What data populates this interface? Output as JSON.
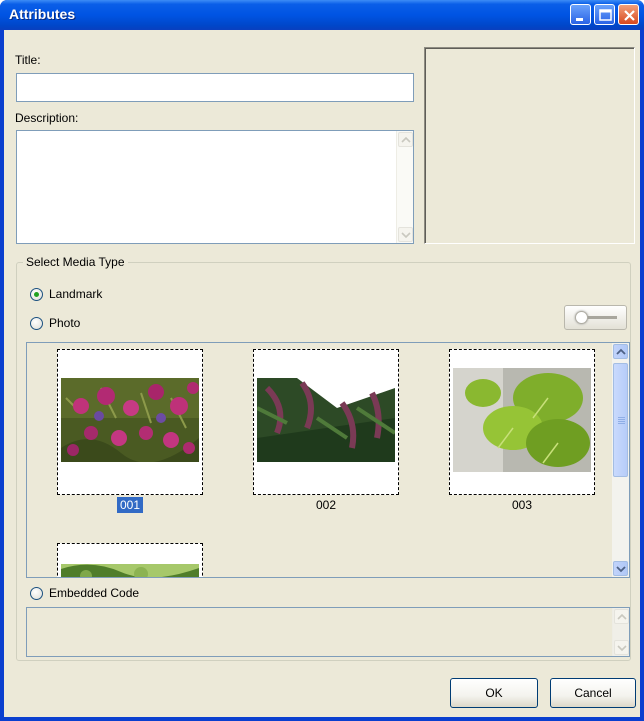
{
  "window": {
    "title": "Attributes",
    "buttons": {
      "minimize": "minimize-icon",
      "maximize": "maximize-icon",
      "close": "close-icon"
    }
  },
  "form": {
    "title_label": "Title:",
    "title_value": "",
    "description_label": "Description:",
    "description_value": ""
  },
  "media": {
    "group_label": "Select Media Type",
    "options": [
      {
        "label": "Landmark",
        "checked": true
      },
      {
        "label": "Photo",
        "checked": false
      },
      {
        "label": "Embedded Code",
        "checked": false
      }
    ],
    "thumbnails": [
      {
        "caption": "001",
        "selected": true
      },
      {
        "caption": "002",
        "selected": false
      },
      {
        "caption": "003",
        "selected": false
      },
      {
        "caption": "",
        "selected": false
      }
    ],
    "embedded_code_value": ""
  },
  "actions": {
    "ok_label": "OK",
    "cancel_label": "Cancel"
  },
  "colors": {
    "title_bar": "#0054e3",
    "face": "#ece9d8",
    "selection": "#316ac5"
  }
}
